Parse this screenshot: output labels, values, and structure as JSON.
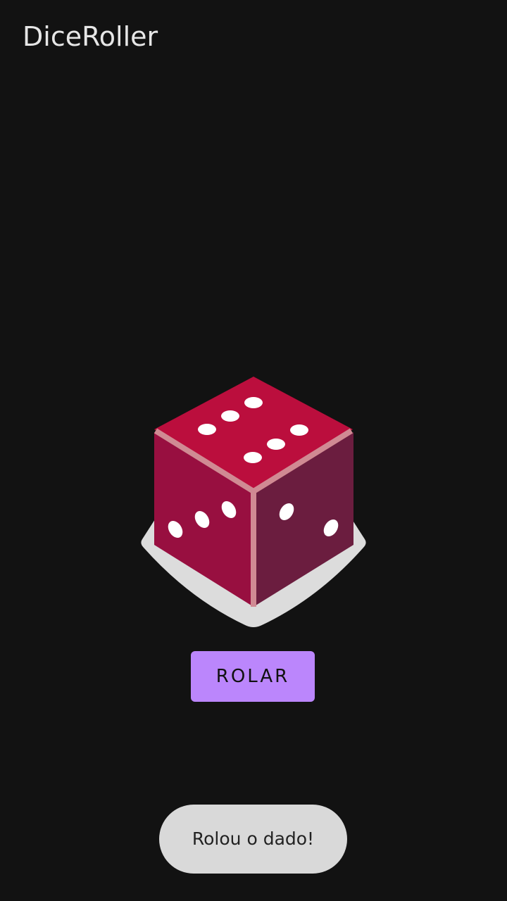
{
  "app_bar": {
    "title": "DiceRoller"
  },
  "dice": {
    "icon": "dice-icon",
    "value": 6,
    "colors": {
      "top_face": "#bb0e3d",
      "left_face": "#980f40",
      "right_face": "#6b1d3f",
      "edges": "#d08a93",
      "pips": "#ffffff",
      "shadow": "#dcdcdc"
    }
  },
  "roll_button": {
    "label": "ROLAR",
    "color": "#bb86fc"
  },
  "toast": {
    "message": "Rolou o dado!"
  }
}
